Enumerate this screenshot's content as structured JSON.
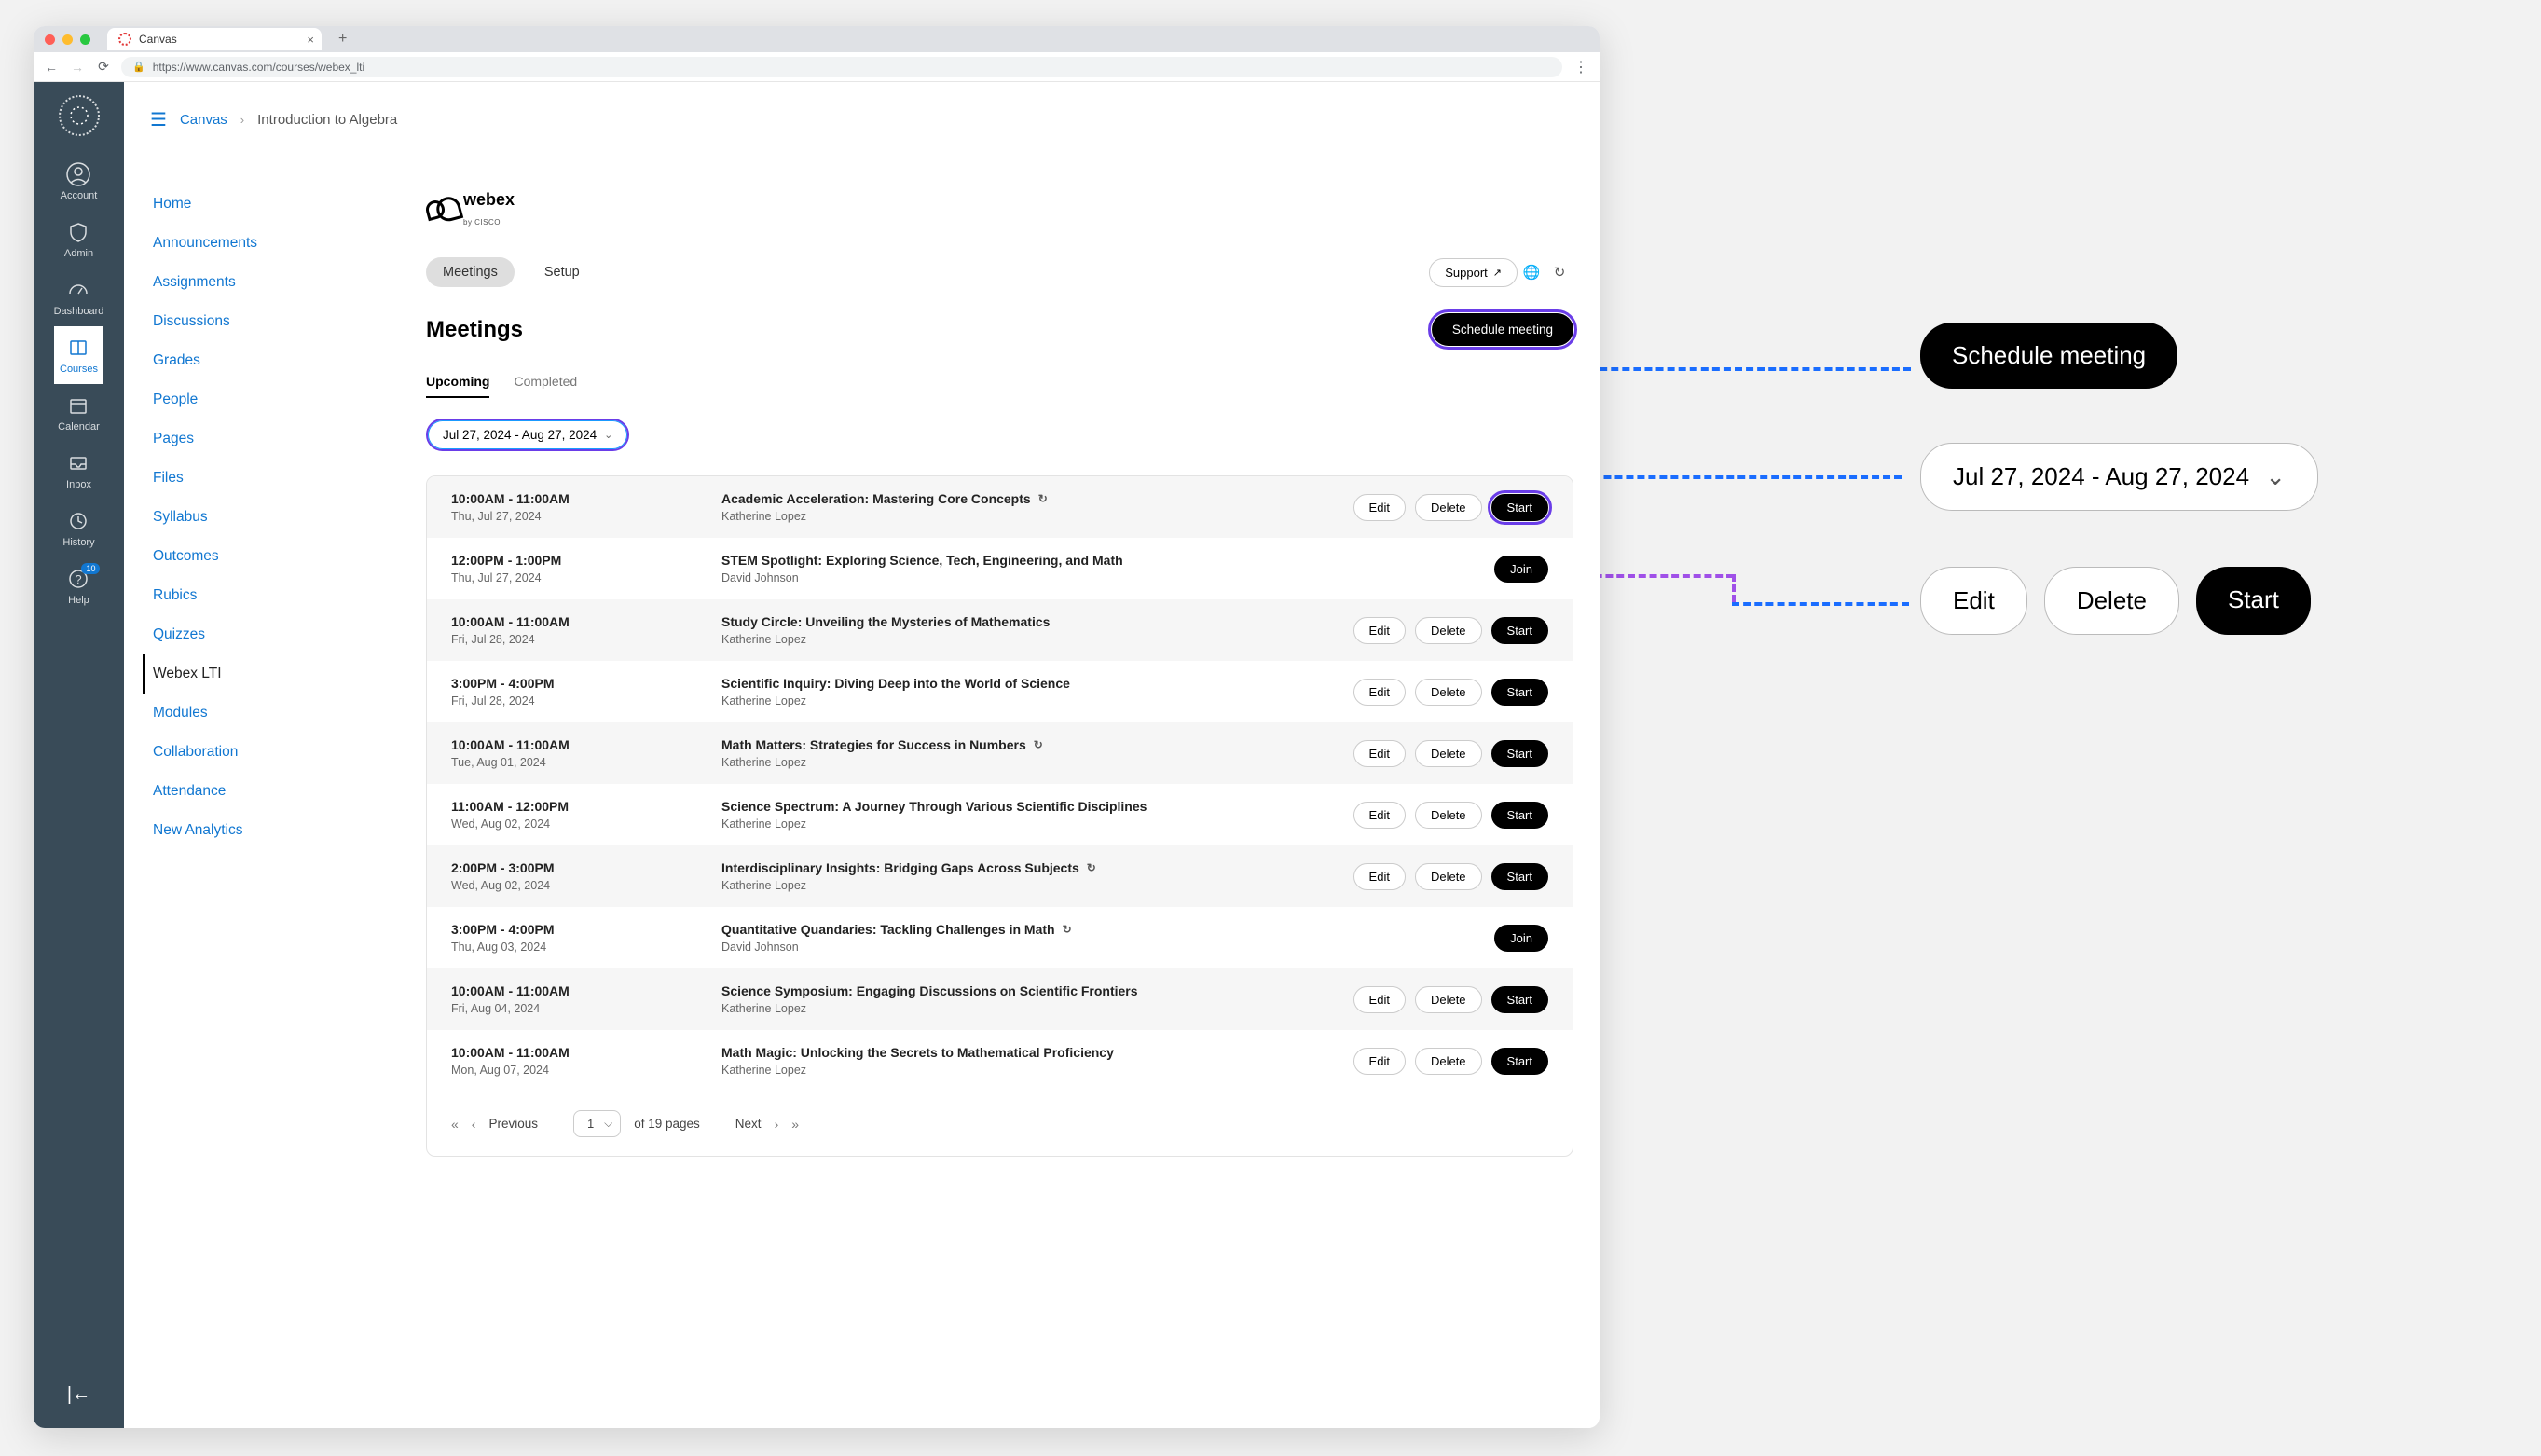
{
  "browser": {
    "tab_title": "Canvas",
    "url": "https://www.canvas.com/courses/webex_lti"
  },
  "rail": {
    "items": [
      {
        "label": "Account",
        "icon": "account-icon"
      },
      {
        "label": "Admin",
        "icon": "admin-icon"
      },
      {
        "label": "Dashboard",
        "icon": "dashboard-icon"
      },
      {
        "label": "Courses",
        "icon": "courses-icon",
        "active": true
      },
      {
        "label": "Calendar",
        "icon": "calendar-icon"
      },
      {
        "label": "Inbox",
        "icon": "inbox-icon"
      },
      {
        "label": "History",
        "icon": "history-icon"
      },
      {
        "label": "Help",
        "icon": "help-icon",
        "badge": "10"
      }
    ]
  },
  "breadcrumb": {
    "root": "Canvas",
    "course": "Introduction to Algebra"
  },
  "course_nav": [
    "Home",
    "Announcements",
    "Assignments",
    "Discussions",
    "Grades",
    "People",
    "Pages",
    "Files",
    "Syllabus",
    "Outcomes",
    "Rubics",
    "Quizzes",
    "Webex LTI",
    "Modules",
    "Collaboration",
    "Attendance",
    "New Analytics"
  ],
  "course_nav_active": "Webex LTI",
  "webex": {
    "logo_text": "webex",
    "logo_sub": "by CISCO",
    "top_tabs": {
      "meetings": "Meetings",
      "setup": "Setup"
    },
    "support": "Support",
    "title": "Meetings",
    "schedule_btn": "Schedule meeting",
    "subtabs": {
      "upcoming": "Upcoming",
      "completed": "Completed"
    },
    "date_range": "Jul 27, 2024 - Aug 27, 2024",
    "actions": {
      "edit": "Edit",
      "delete": "Delete",
      "start": "Start",
      "join": "Join"
    },
    "pagination": {
      "previous": "Previous",
      "next": "Next",
      "page": "1",
      "of_pages": "of 19 pages"
    }
  },
  "meetings": [
    {
      "time": "10:00AM - 11:00AM",
      "date": "Thu, Jul 27, 2024",
      "title": "Academic Acceleration: Mastering Core Concepts",
      "host": "Katherine Lopez",
      "recurring": true,
      "type": "owner",
      "highlight": true
    },
    {
      "time": "12:00PM - 1:00PM",
      "date": "Thu, Jul 27, 2024",
      "title": "STEM Spotlight: Exploring Science, Tech, Engineering, and Math",
      "host": "David Johnson",
      "recurring": false,
      "type": "join"
    },
    {
      "time": "10:00AM - 11:00AM",
      "date": "Fri, Jul 28, 2024",
      "title": "Study Circle: Unveiling the Mysteries of Mathematics",
      "host": "Katherine Lopez",
      "recurring": false,
      "type": "owner"
    },
    {
      "time": "3:00PM - 4:00PM",
      "date": "Fri, Jul 28, 2024",
      "title": "Scientific Inquiry: Diving Deep into the World of Science",
      "host": "Katherine Lopez",
      "recurring": false,
      "type": "owner"
    },
    {
      "time": "10:00AM - 11:00AM",
      "date": "Tue, Aug 01, 2024",
      "title": "Math Matters: Strategies for Success in Numbers",
      "host": "Katherine Lopez",
      "recurring": true,
      "type": "owner"
    },
    {
      "time": "11:00AM - 12:00PM",
      "date": "Wed, Aug 02, 2024",
      "title": "Science Spectrum: A Journey Through Various Scientific Disciplines",
      "host": "Katherine Lopez",
      "recurring": false,
      "type": "owner"
    },
    {
      "time": "2:00PM - 3:00PM",
      "date": "Wed, Aug 02, 2024",
      "title": "Interdisciplinary Insights: Bridging Gaps Across Subjects",
      "host": "Katherine Lopez",
      "recurring": true,
      "type": "owner"
    },
    {
      "time": "3:00PM - 4:00PM",
      "date": "Thu, Aug 03, 2024",
      "title": "Quantitative Quandaries: Tackling Challenges in Math",
      "host": "David Johnson",
      "recurring": true,
      "type": "join"
    },
    {
      "time": "10:00AM - 11:00AM",
      "date": "Fri, Aug 04, 2024",
      "title": "Science Symposium: Engaging Discussions on Scientific Frontiers",
      "host": "Katherine Lopez",
      "recurring": false,
      "type": "owner"
    },
    {
      "time": "10:00AM - 11:00AM",
      "date": "Mon, Aug 07, 2024",
      "title": "Math Magic: Unlocking the Secrets to Mathematical Proficiency",
      "host": "Katherine Lopez",
      "recurring": false,
      "type": "owner"
    }
  ],
  "callouts": {
    "schedule": "Schedule meeting",
    "date_range": "Jul 27, 2024 - Aug 27, 2024",
    "edit": "Edit",
    "delete": "Delete",
    "start": "Start"
  }
}
